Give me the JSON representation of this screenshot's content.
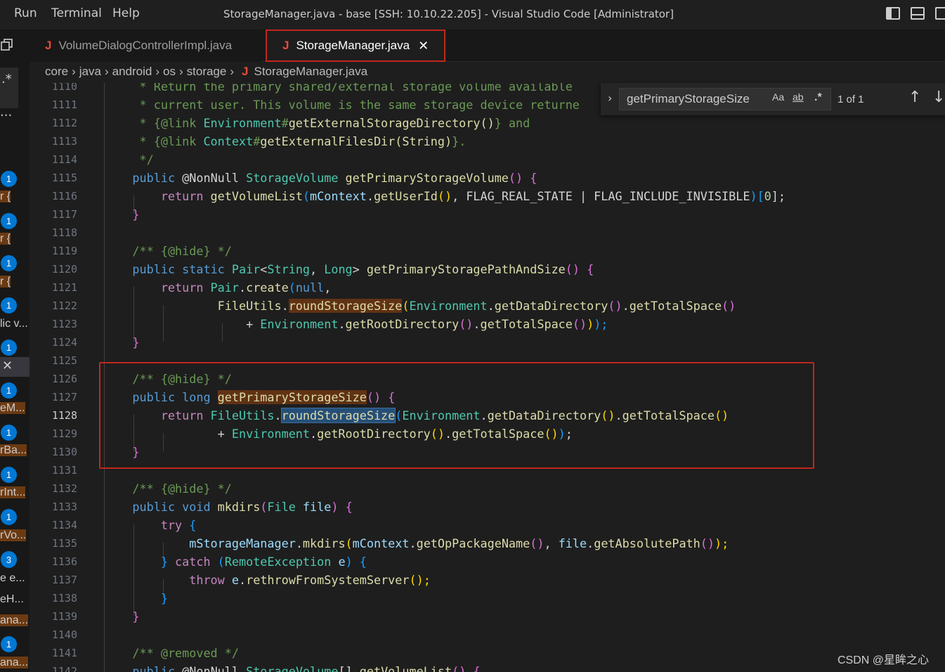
{
  "menu": {
    "run": "Run",
    "terminal": "Terminal",
    "help": "Help"
  },
  "window_title": "StorageManager.java - base [SSH: 10.10.22.205] - Visual Studio Code [Administrator]",
  "tabs": [
    {
      "icon": "J",
      "label": "VolumeDialogControllerImpl.java"
    },
    {
      "icon": "J",
      "label": "StorageManager.java",
      "close": "✕"
    }
  ],
  "breadcrumb": [
    "core",
    "java",
    "android",
    "os",
    "storage",
    "StorageManager.java"
  ],
  "breadcrumb_file_icon": "J",
  "find": {
    "toggle": "›",
    "value": "getPrimaryStorageSize",
    "opt_case": "Aa",
    "opt_word": "ab",
    "opt_regex": ".*",
    "count": "1 of 1",
    "prev": "↑",
    "next": "↓"
  },
  "left_stubs": {
    "badges": [
      "1",
      "1",
      "1",
      "1",
      "1",
      "1",
      "1",
      "1",
      "1",
      "1",
      "3",
      "1"
    ],
    "texts": [
      "r {",
      "r {",
      "r {",
      "lic v...",
      "eM...",
      "rBa...",
      "rInt...",
      "rVo...",
      "e e...",
      "eH...",
      "ana...",
      "ana..."
    ]
  },
  "line_numbers": [
    "1110",
    "1111",
    "1112",
    "1113",
    "1114",
    "1115",
    "1116",
    "1117",
    "1118",
    "1119",
    "1120",
    "1121",
    "1122",
    "1123",
    "1124",
    "1125",
    "1126",
    "1127",
    "1128",
    "1129",
    "1130",
    "1131",
    "1132",
    "1133",
    "1134",
    "1135",
    "1136",
    "1137",
    "1138",
    "1139",
    "1140",
    "1141",
    "1142"
  ],
  "active_line": "1128",
  "code": {
    "l1110": "     * Return the primary shared/external storage volume available",
    "l1111a": "     * current user. This volume is the same storage device returne",
    "l1112a": "     * {@link ",
    "l1112b": "Environment",
    "l1112c": "#",
    "l1112d": "getExternalStorageDirectory",
    "l1112e": "()",
    "l1112f": "} and",
    "l1113a": "     * {@link ",
    "l1113b": "Context",
    "l1113c": "#",
    "l1113d": "getExternalFilesDir",
    "l1113e": "(String)",
    "l1113f": "}.",
    "l1114": "     */",
    "l1115a": "public",
    "l1115b": " @NonNull ",
    "l1115c": "StorageVolume",
    "l1115d": " getPrimaryStorageVolume",
    "l1115e": "()",
    "l1115f": " {",
    "l1116a": "return",
    "l1116b": " getVolumeList",
    "l1116c": "(",
    "l1116d": "mContext",
    "l1116e": ".",
    "l1116f": "getUserId",
    "l1116g": "()",
    "l1116h": ", FLAG_REAL_STATE | FLAG_INCLUDE_INVISIBLE",
    "l1116i": ")",
    "l1116j": "[",
    "l1116k": "0",
    "l1116l": "];",
    "l1117": "}",
    "l1119": "/** {@hide} */",
    "l1120a": "public",
    "l1120b": " static ",
    "l1120c": "Pair",
    "l1120d": "<",
    "l1120e": "String",
    "l1120f": ", ",
    "l1120g": "Long",
    "l1120h": ">",
    "l1120i": " getPrimaryStoragePathAndSize",
    "l1120j": "()",
    "l1120k": " {",
    "l1121a": "return",
    "l1121b": " Pair",
    "l1121c": ".",
    "l1121d": "create",
    "l1121e": "(",
    "l1121f": "null",
    "l1121g": ",",
    "l1122a": "FileUtils",
    "l1122b": ".",
    "l1122c": "roundStorageSize",
    "l1122d": "(",
    "l1122e": "Environment",
    "l1122f": ".",
    "l1122g": "getDataDirectory",
    "l1122h": "()",
    "l1122i": ".",
    "l1122j": "getTotalSpace",
    "l1122k": "()",
    "l1123a": "+ ",
    "l1123b": "Environment",
    "l1123c": ".",
    "l1123d": "getRootDirectory",
    "l1123e": "()",
    "l1123f": ".",
    "l1123g": "getTotalSpace",
    "l1123h": "()",
    "l1123i": ")",
    "l1123j": ");",
    "l1124": "}",
    "l1126": "/** {@hide} */",
    "l1127a": "public",
    "l1127b": " long ",
    "l1127c": "getPrimaryStorageSize",
    "l1127d": "()",
    "l1127e": " {",
    "l1128a": "return",
    "l1128b": " FileUtils",
    "l1128c": ".",
    "l1128d": "roundStorageSize",
    "l1128e": "(",
    "l1128f": "Environment",
    "l1128g": ".",
    "l1128h": "getDataDirectory",
    "l1128i": "()",
    "l1128j": ".",
    "l1128k": "getTotalSpace",
    "l1128l": "()",
    "l1129a": "+ ",
    "l1129b": "Environment",
    "l1129c": ".",
    "l1129d": "getRootDirectory",
    "l1129e": "()",
    "l1129f": ".",
    "l1129g": "getTotalSpace",
    "l1129h": "()",
    "l1129i": ")",
    "l1129j": ";",
    "l1130": "}",
    "l1132": "/** {@hide} */",
    "l1133a": "public",
    "l1133b": " void ",
    "l1133c": "mkdirs",
    "l1133d": "(",
    "l1133e": "File",
    "l1133f": " file",
    "l1133g": ")",
    "l1133h": " {",
    "l1134a": "try",
    "l1134b": " {",
    "l1135a": "mStorageManager",
    "l1135b": ".",
    "l1135c": "mkdirs",
    "l1135d": "(",
    "l1135e": "mContext",
    "l1135f": ".",
    "l1135g": "getOpPackageName",
    "l1135h": "()",
    "l1135i": ", ",
    "l1135j": "file",
    "l1135k": ".",
    "l1135l": "getAbsolutePath",
    "l1135m": "()",
    "l1135n": ");",
    "l1136a": "}",
    "l1136b": " catch ",
    "l1136c": "(",
    "l1136d": "RemoteException",
    "l1136e": " e",
    "l1136f": ")",
    "l1136g": " {",
    "l1137a": "throw",
    "l1137b": " e",
    "l1137c": ".",
    "l1137d": "rethrowFromSystemServer",
    "l1137e": "();",
    "l1138": "}",
    "l1139": "}",
    "l1141": "/** @removed */",
    "l1142a": "public",
    "l1142b": " @NonNull ",
    "l1142c": "StorageVolume",
    "l1142d": "[]",
    "l1142e": " getVolumeList",
    "l1142f": "()",
    "l1142g": " {"
  },
  "watermark": "CSDN @星眸之心",
  "colors": {
    "background": "#1e1e1e",
    "keyword": "#569cd6",
    "control": "#c586c0",
    "type": "#4ec9b0",
    "function": "#dcdcaa",
    "variable": "#9cdcfe",
    "comment": "#6a9955",
    "annotation_box": "#c1271d",
    "badge": "#0078d4"
  }
}
